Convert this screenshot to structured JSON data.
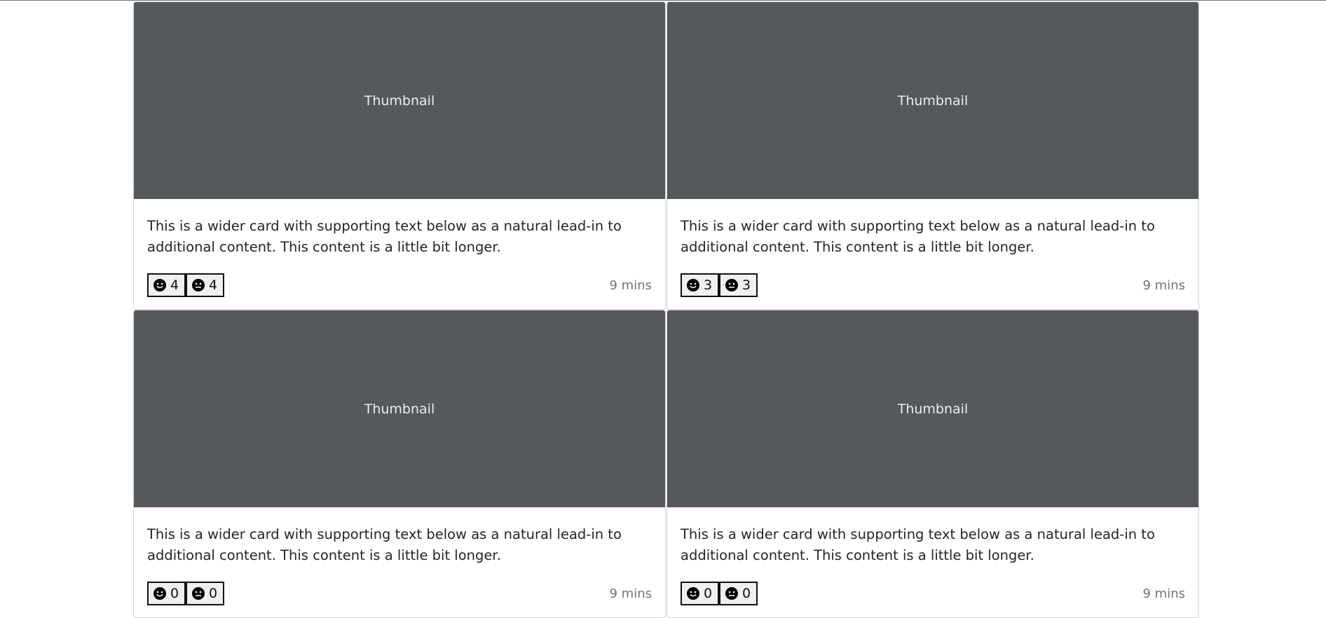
{
  "cards": [
    {
      "thumbnail_label": "Thumbnail",
      "text": "This is a wider card with supporting text below as a natural lead-in to additional content. This content is a little bit longer.",
      "smile_count": "4",
      "neutral_count": "4",
      "time": "9 mins"
    },
    {
      "thumbnail_label": "Thumbnail",
      "text": "This is a wider card with supporting text below as a natural lead-in to additional content. This content is a little bit longer.",
      "smile_count": "3",
      "neutral_count": "3",
      "time": "9 mins"
    },
    {
      "thumbnail_label": "Thumbnail",
      "text": "This is a wider card with supporting text below as a natural lead-in to additional content. This content is a little bit longer.",
      "smile_count": "0",
      "neutral_count": "0",
      "time": "9 mins"
    },
    {
      "thumbnail_label": "Thumbnail",
      "text": "This is a wider card with supporting text below as a natural lead-in to additional content. This content is a little bit longer.",
      "smile_count": "0",
      "neutral_count": "0",
      "time": "9 mins"
    }
  ],
  "icons": {
    "smile": "smiley-face-icon",
    "neutral": "neutral-face-icon"
  },
  "colors": {
    "thumbnail_bg": "#55595c",
    "thumbnail_text": "#eceeef",
    "body_text": "#212529",
    "muted_text": "#6c757d"
  }
}
